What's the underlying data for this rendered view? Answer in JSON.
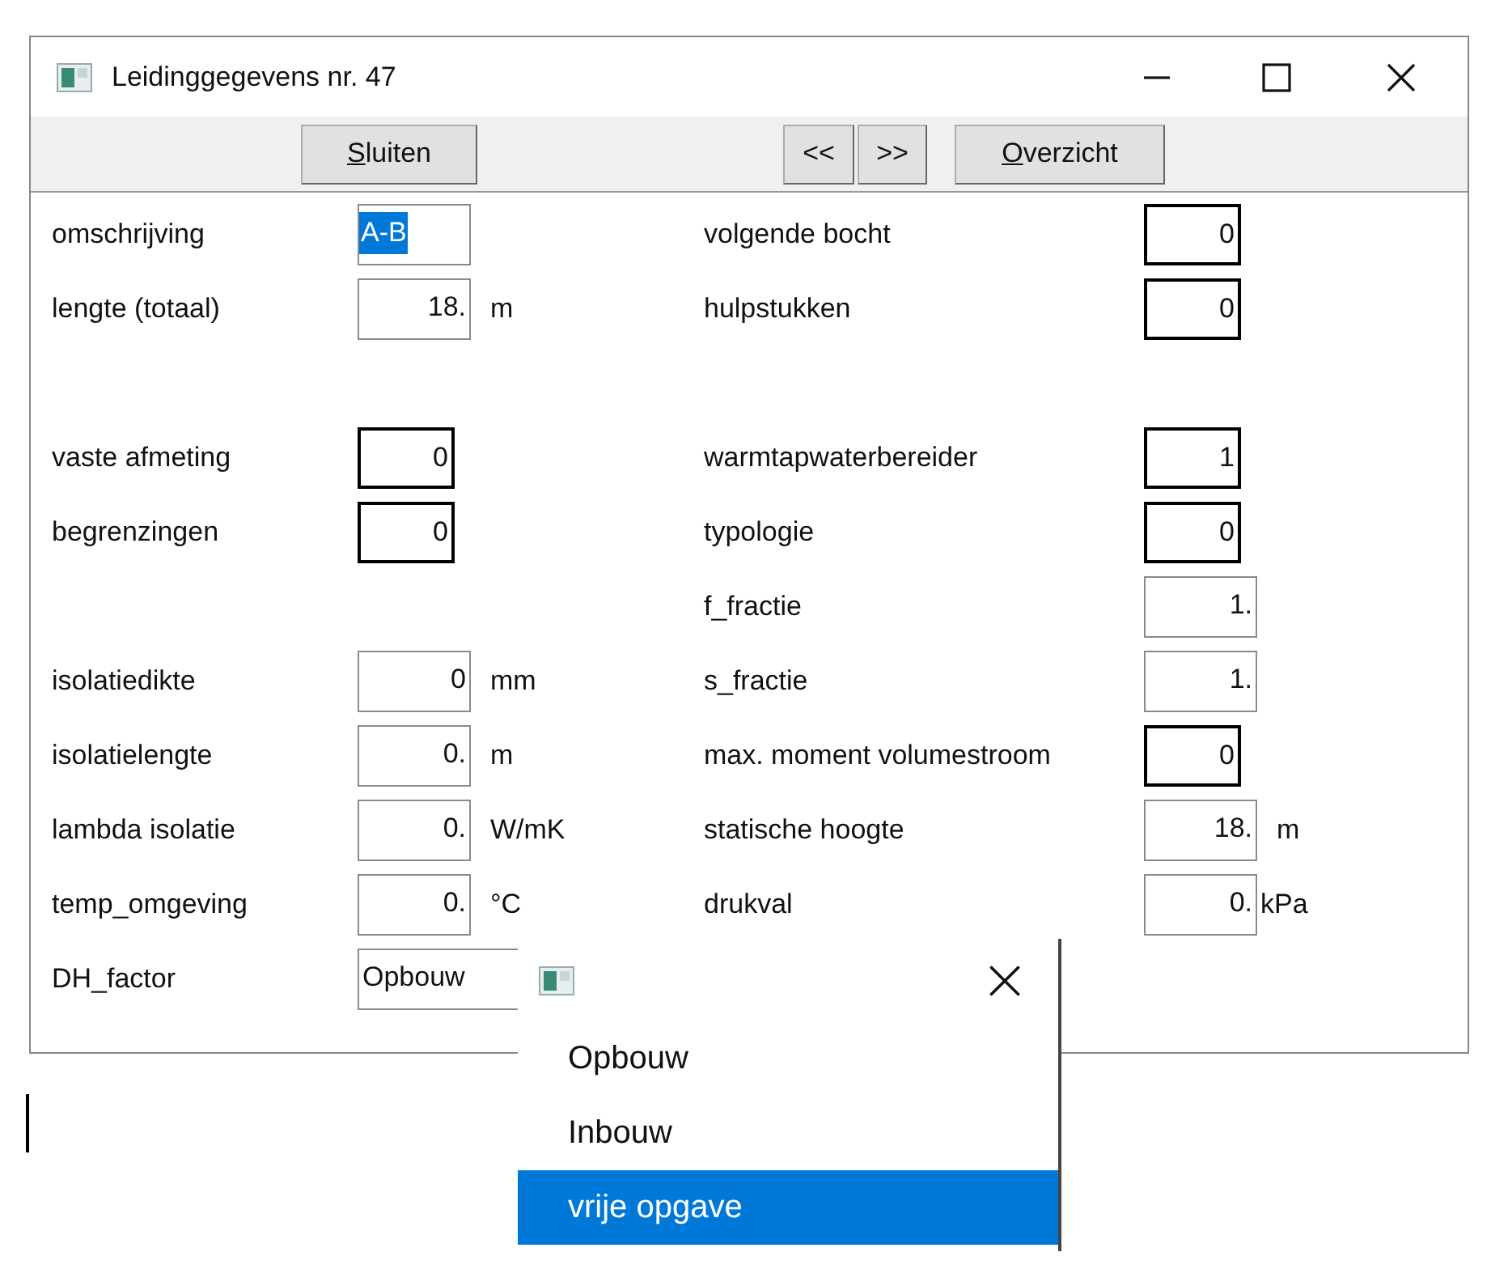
{
  "window": {
    "title": "Leidinggegevens nr. 47"
  },
  "toolbar": [
    {
      "label": "Sluiten",
      "mnemonic_underlined": true
    },
    {
      "label": "<<",
      "mnemonic_underlined": false
    },
    {
      "label": ">>",
      "mnemonic_underlined": false
    },
    {
      "label": "Overzicht",
      "mnemonic_underlined": true
    }
  ],
  "rows": [
    {
      "left": {
        "label": "omschrijving",
        "kind": "text",
        "value": "A-B",
        "bold": false,
        "highlighted": true
      },
      "right": {
        "label": "volgende bocht",
        "kind": "number",
        "value": "0",
        "bold": true
      }
    },
    {
      "left": {
        "label": "lengte (totaal)",
        "kind": "number",
        "value": "18.",
        "bold": false,
        "unit": "m"
      },
      "right": {
        "label": "hulpstukken",
        "kind": "number",
        "value": "0",
        "bold": true
      }
    },
    {},
    {
      "left": {
        "label": "vaste afmeting",
        "kind": "number",
        "value": "0",
        "bold": true
      },
      "right": {
        "label": "warmtapwaterbereider",
        "kind": "number",
        "value": "1",
        "bold": true
      }
    },
    {
      "left": {
        "label": "begrenzingen",
        "kind": "number",
        "value": "0",
        "bold": true
      },
      "right": {
        "label": "typologie",
        "kind": "number",
        "value": "0",
        "bold": true
      }
    },
    {
      "right": {
        "label": "f_fractie",
        "kind": "number",
        "value": "1.",
        "bold": false
      }
    },
    {
      "left": {
        "label": "isolatiedikte",
        "kind": "number",
        "value": "0",
        "bold": false,
        "unit": "mm"
      },
      "right": {
        "label": "s_fractie",
        "kind": "number",
        "value": "1.",
        "bold": false
      }
    },
    {
      "left": {
        "label": "isolatielengte",
        "kind": "number",
        "value": "0.",
        "bold": false,
        "unit": "m"
      },
      "right": {
        "label": "max. moment volumestroom",
        "kind": "number",
        "value": "0",
        "bold": true
      }
    },
    {
      "left": {
        "label": "lambda isolatie",
        "kind": "number",
        "value": "0.",
        "bold": false,
        "unit": "W/mK"
      },
      "right": {
        "label": "statische hoogte",
        "kind": "number",
        "value": "18.",
        "bold": false,
        "unit": "m"
      }
    },
    {
      "left": {
        "label": "temp_omgeving",
        "kind": "number",
        "value": "0.",
        "bold": false,
        "unit": "°C"
      },
      "right": {
        "label": "drukval",
        "kind": "number",
        "value": "0.",
        "bold": false,
        "unit": "kPa"
      }
    },
    {
      "left": {
        "label": "DH_factor",
        "kind": "dropdown",
        "value": "Opbouw",
        "bold": false
      }
    }
  ],
  "dropdown_list": {
    "items": [
      {
        "label": "Opbouw",
        "selected": false
      },
      {
        "label": "Inbouw",
        "selected": false
      },
      {
        "label": "vrije opgave",
        "selected": true
      }
    ]
  }
}
